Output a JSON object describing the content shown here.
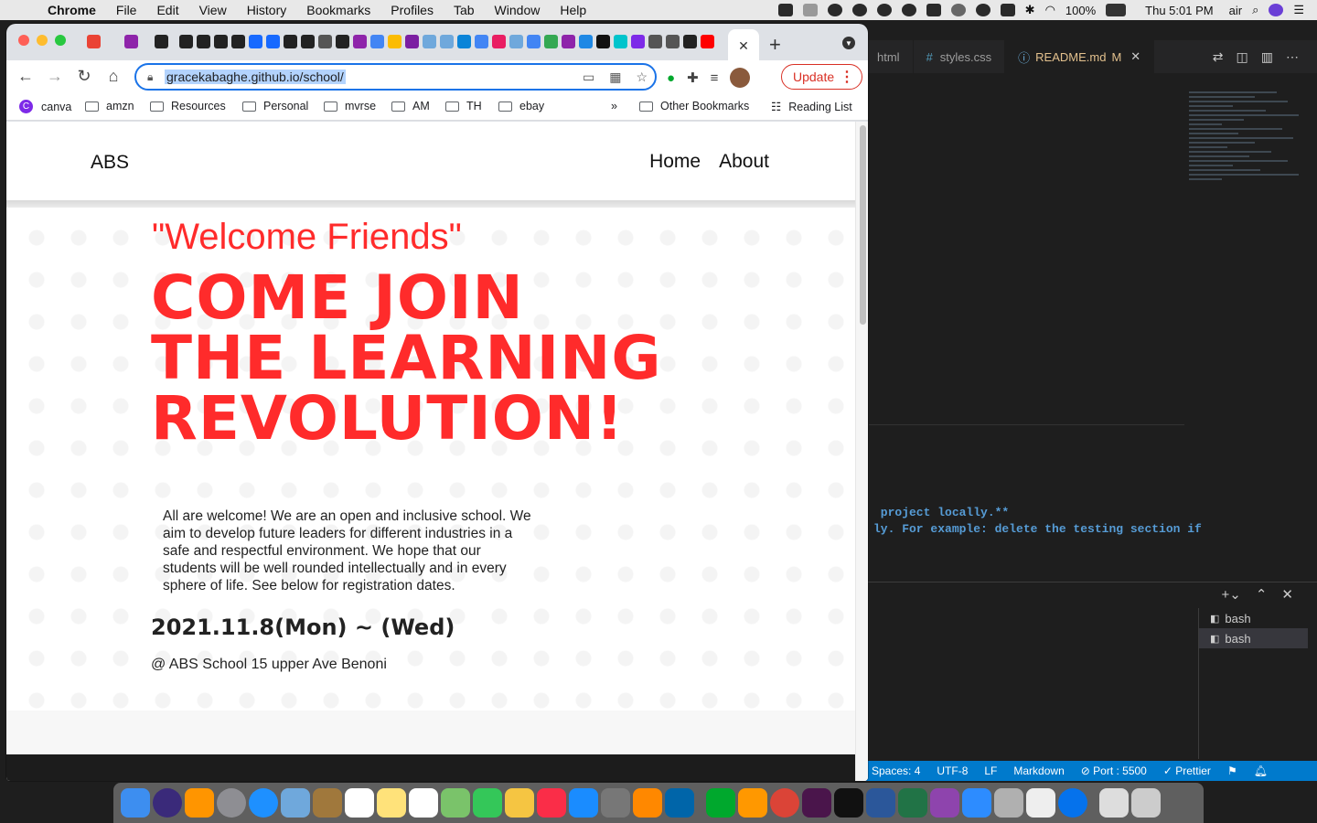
{
  "menubar": {
    "app": "Chrome",
    "items": [
      "File",
      "Edit",
      "View",
      "History",
      "Bookmarks",
      "Profiles",
      "Tab",
      "Window",
      "Help"
    ],
    "battery": "100%",
    "clock": "Thu 5:01 PM",
    "user": "air"
  },
  "browser": {
    "url": "gracekabaghe.github.io/school/",
    "update_label": "Update",
    "bookmarks": [
      "canva",
      "amzn",
      "Resources",
      "Personal",
      "mvrse",
      "AM",
      "TH",
      "ebay"
    ],
    "other_bookmarks": "Other Bookmarks",
    "reading_list": "Reading List",
    "chevron": "»"
  },
  "site": {
    "brand": "ABS",
    "nav": [
      "Home",
      "About"
    ],
    "welcome": "\"Welcome Friends\"",
    "headline": [
      "COME JOIN",
      "THE LEARNING",
      "REVOLUTION!"
    ],
    "blurb": "All are welcome! We are an open and inclusive school. We aim to develop future leaders for different industries in a safe and respectful environment. We hope that our students will be well rounded intellectually and in every sphere of life. See below for registration dates.",
    "date": "2021.11.8(Mon) ~ (Wed)",
    "venue": "@ ABS School 15 upper Ave Benoni"
  },
  "vscode": {
    "tabs": [
      "html",
      "styles.css",
      "README.md"
    ],
    "modified_marker": "M",
    "code_lines": [
      " project locally.**",
      "ly. For example: delete the testing section if"
    ],
    "terminals": [
      "bash",
      "bash"
    ],
    "status": [
      "Spaces: 4",
      "UTF-8",
      "LF",
      "Markdown",
      "Port : 5500",
      "Prettier"
    ]
  },
  "icons": {
    "accent": "#ff2b2b",
    "omnibox_border": "#1a73e8",
    "vscode_status": "#007acc"
  }
}
